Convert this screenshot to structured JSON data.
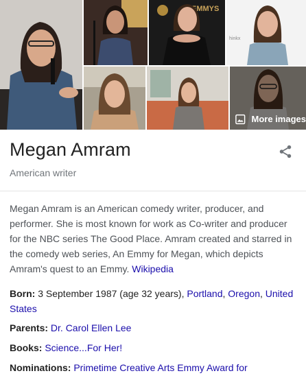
{
  "images": {
    "more_label": "More images"
  },
  "header": {
    "title": "Megan Amram",
    "subtitle": "American writer"
  },
  "description": {
    "text": "Megan Amram is an American comedy writer, producer, and performer. She is most known for work as Co-writer and producer for the NBC series The Good Place. Amram created and starred in the comedy web series, An Emmy for Megan, which depicts Amram's quest to an Emmy.",
    "source_link": "Wikipedia"
  },
  "facts": {
    "born": {
      "label": "Born:",
      "text": "3 September 1987 (age 32 years),",
      "link1": "Portland",
      "sep1": ",",
      "link2": "Oregon",
      "sep2": ",",
      "link3": "United States"
    },
    "parents": {
      "label": "Parents:",
      "link": "Dr. Carol Ellen Lee"
    },
    "books": {
      "label": "Books:",
      "link": "Science...For Her!"
    },
    "nominations": {
      "label": "Nominations:",
      "link": "Primetime Creative Arts Emmy Award for"
    }
  },
  "colors": {
    "link": "#1a0dab",
    "title": "#222222",
    "subtitle": "#70757a",
    "body": "#4d5156"
  },
  "icons": {
    "share": "share-icon",
    "more_images": "image-gallery-icon"
  }
}
